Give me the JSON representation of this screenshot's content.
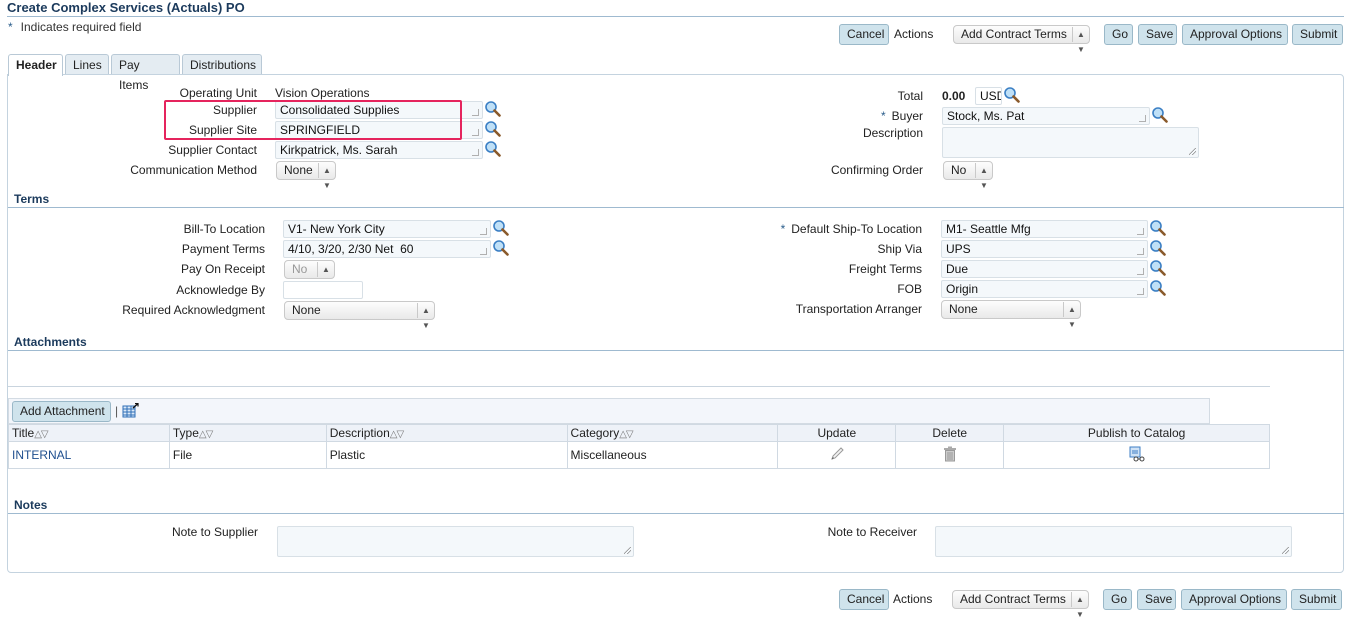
{
  "page": {
    "title": "Create Complex Services (Actuals) PO",
    "required_note": "Indicates required field",
    "required_marker": "*"
  },
  "actions_bar": {
    "cancel_label": "Cancel",
    "actions_label": "Actions",
    "actions_select": "Add Contract Terms",
    "go_label": "Go",
    "save_label": "Save",
    "approval_options_label": "Approval Options",
    "submit_label": "Submit"
  },
  "tabs": [
    {
      "label": "Header",
      "active": true
    },
    {
      "label": "Lines",
      "active": false
    },
    {
      "label": "Pay Items",
      "active": false
    },
    {
      "label": "Distributions",
      "active": false
    }
  ],
  "header": {
    "operating_unit": {
      "label": "Operating Unit",
      "value": "Vision Operations"
    },
    "supplier": {
      "label": "Supplier",
      "value": "Consolidated Supplies"
    },
    "supplier_site": {
      "label": "Supplier Site",
      "value": "SPRINGFIELD"
    },
    "supplier_contact": {
      "label": "Supplier Contact",
      "value": "Kirkpatrick, Ms. Sarah"
    },
    "communication_method": {
      "label": "Communication Method",
      "value": "None"
    },
    "total": {
      "label": "Total",
      "value": "0.00",
      "currency": "USD"
    },
    "buyer": {
      "label": "Buyer",
      "value": "Stock, Ms. Pat",
      "required": true
    },
    "description": {
      "label": "Description",
      "value": ""
    },
    "confirming_order": {
      "label": "Confirming Order",
      "value": "No"
    }
  },
  "terms": {
    "title": "Terms",
    "bill_to_location": {
      "label": "Bill-To Location",
      "value": "V1- New York City"
    },
    "payment_terms": {
      "label": "Payment Terms",
      "value": "4/10, 3/20, 2/30 Net  60"
    },
    "pay_on_receipt": {
      "label": "Pay On Receipt",
      "value": "No"
    },
    "acknowledge_by": {
      "label": "Acknowledge By",
      "value": ""
    },
    "required_acknowledgment": {
      "label": "Required Acknowledgment",
      "value": "None"
    },
    "default_ship_to": {
      "label": "Default Ship-To Location",
      "value": "M1- Seattle Mfg",
      "required": true
    },
    "ship_via": {
      "label": "Ship Via",
      "value": "UPS"
    },
    "freight_terms": {
      "label": "Freight Terms",
      "value": "Due"
    },
    "fob": {
      "label": "FOB",
      "value": "Origin"
    },
    "transportation_arranger": {
      "label": "Transportation Arranger",
      "value": "None"
    }
  },
  "attachments": {
    "title": "Attachments",
    "add_button": "Add Attachment",
    "separator": "|",
    "columns": [
      "Title",
      "Type",
      "Description",
      "Category",
      "Update",
      "Delete",
      "Publish to Catalog"
    ],
    "sort_glyph": "△▽",
    "rows": [
      {
        "title": "INTERNAL",
        "type": "File",
        "description": "Plastic",
        "category": "Miscellaneous"
      }
    ]
  },
  "notes": {
    "title": "Notes",
    "note_to_supplier": {
      "label": "Note to Supplier",
      "value": ""
    },
    "note_to_receiver": {
      "label": "Note to Receiver",
      "value": ""
    }
  },
  "icons": {
    "lookup": "magnifier-icon",
    "select_arrows": "⇕",
    "update": "pencil-icon",
    "delete": "trash-icon",
    "publish": "publish-catalog-icon",
    "export": "export-table-icon"
  },
  "colors": {
    "highlight": "#e5245d",
    "button_bg": "#cfe3ec",
    "section_title": "#1b3a5c",
    "link": "#1f4f8f"
  }
}
